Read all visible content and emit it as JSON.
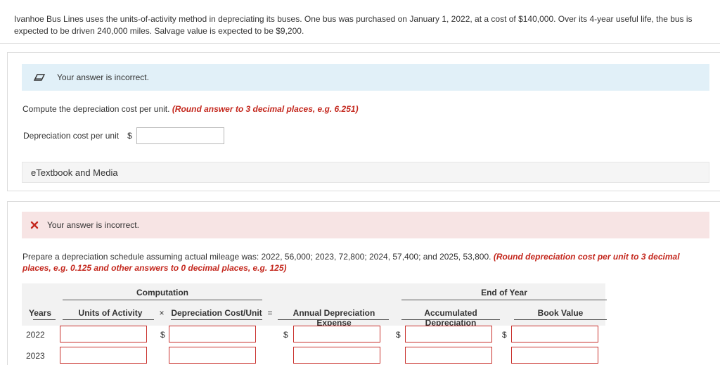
{
  "problem": {
    "text": "Ivanhoe Bus Lines uses the units-of-activity method in depreciating its buses. One bus was purchased on January 1, 2022, at a cost of $140,000. Over its 4-year useful life, the bus is expected to be driven 240,000 miles. Salvage value is expected to be $9,200."
  },
  "part1": {
    "banner": "Your answer is incorrect.",
    "question": "Compute the depreciation cost per unit.",
    "hint": "(Round answer to 3 decimal places, e.g. 6.251)",
    "field_label": "Depreciation cost per unit",
    "currency": "$",
    "field_value": "",
    "etextbook": "eTextbook and Media"
  },
  "part2": {
    "banner": "Your answer is incorrect.",
    "question": "Prepare a depreciation schedule assuming actual mileage was: 2022, 56,000; 2023, 72,800; 2024, 57,400; and 2025, 53,800.",
    "hint": "(Round depreciation cost per unit to 3 decimal places, e.g. 0.125 and other answers to 0 decimal places, e.g. 125)",
    "table": {
      "group_computation": "Computation",
      "group_end_of_year": "End of Year",
      "col_years": "Years",
      "col_units": "Units of Activity",
      "op_times": "×",
      "col_cost_unit": "Depreciation Cost/Unit",
      "op_equals": "=",
      "col_annual": "Annual Depreciation Expense",
      "col_accum": "Accumulated Depreciation",
      "col_book": "Book Value",
      "currency": "$",
      "rows": [
        {
          "year": "2022"
        },
        {
          "year": "2023"
        }
      ]
    }
  },
  "colors": {
    "info_banner": "#e1f0f8",
    "error_banner": "#f7e4e4",
    "hint_red": "#c4281e",
    "error_border": "#c9302c"
  }
}
